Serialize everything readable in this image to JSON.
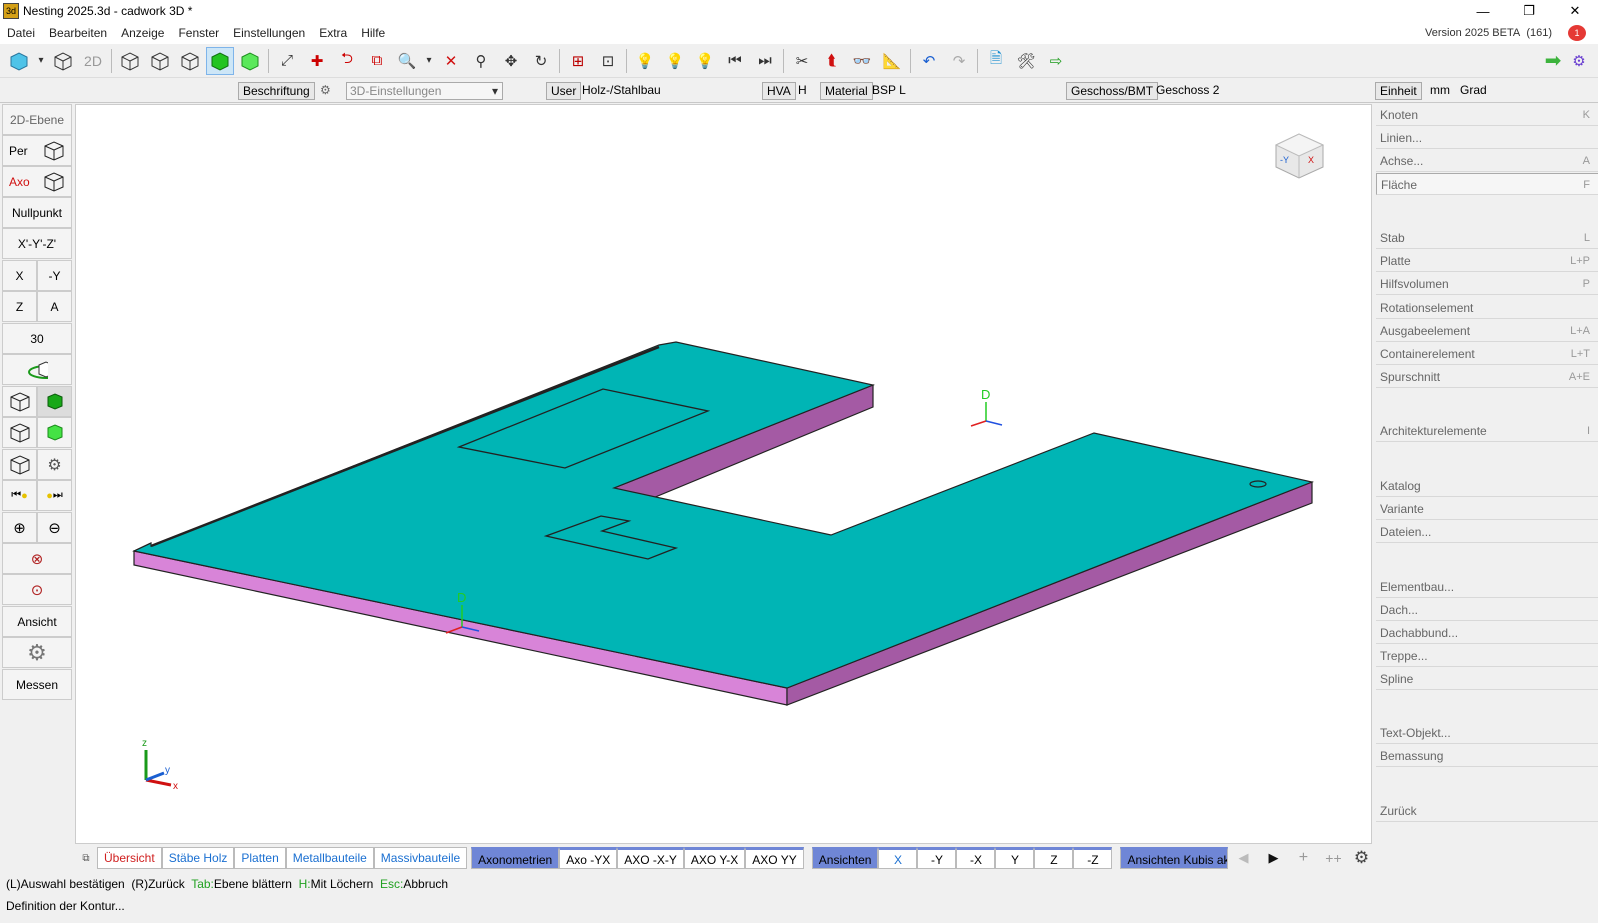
{
  "window": {
    "title": "Nesting 2025.3d - cadwork 3D *",
    "app_icon": "cadwork-3d-icon",
    "controls": [
      "minimize-icon",
      "restore-icon",
      "close-icon"
    ]
  },
  "menu": {
    "items": [
      "Datei",
      "Bearbeiten",
      "Anzeige",
      "Fenster",
      "Einstellungen",
      "Extra",
      "Hilfe"
    ],
    "version": "Version 2025 BETA",
    "build": "(161)",
    "alert_count": "1"
  },
  "toolbar": {
    "label_2d": "2D",
    "icons": [
      "cube-color-icon",
      "cube-wire-icon",
      "2d-icon",
      "cube-icon",
      "cube-icon",
      "cube-icon",
      "cube-green-icon",
      "cube-green-icon",
      "line-icon",
      "plus-icon",
      "rotate-icon",
      "copy-icon",
      "zoom-icon",
      "delete-icon",
      "move-icon",
      "pan-icon",
      "refresh-icon",
      "select-icon",
      "select-icon",
      "bulb-icon",
      "bulb-icon",
      "bulb-icon",
      "prev-icon",
      "next-icon",
      "scissors-icon",
      "axis-icon",
      "binoculars-icon",
      "ruler-icon",
      "undo-icon",
      "redo-icon",
      "add-icon",
      "tools-icon",
      "export-icon"
    ]
  },
  "propbar": {
    "beschriftung": "Beschriftung",
    "einstellungen": "3D-Einstellungen",
    "user_label": "User",
    "user_value": "Holz-/Stahlbau",
    "hva_label": "HVA",
    "hva_value": "H",
    "material_label": "Material",
    "material_value": "BSP L",
    "geschoss_label": "Geschoss/BMT",
    "geschoss_value": "Geschoss 2",
    "einheit_label": "Einheit",
    "unit_length": "mm",
    "unit_angle": "Grad"
  },
  "leftpanel": {
    "ebene": "2D-Ebene",
    "per": "Per",
    "axo": "Axo",
    "nullpunkt": "Nullpunkt",
    "xyz": "X'-Y'-Z'",
    "x": "X",
    "my": "-Y",
    "z": "Z",
    "a": "A",
    "thirty": "30",
    "ansicht": "Ansicht",
    "messen": "Messen"
  },
  "viewport": {
    "local_axis_label": "D",
    "global_axis_z": "z",
    "global_axis_y": "y",
    "global_axis_x": "x",
    "cube_y": "-Y",
    "cube_x": "X",
    "colors": {
      "top": "#00b5b5",
      "side": "#d47fd4",
      "side_dark": "#a45aa4"
    }
  },
  "rightpanel": {
    "items": [
      {
        "label": "Knoten",
        "shortcut": "K"
      },
      {
        "label": "Linien...",
        "shortcut": ""
      },
      {
        "label": "Achse...",
        "shortcut": "A"
      },
      {
        "label": "Fläche",
        "shortcut": "F"
      },
      {
        "label": "Stab",
        "shortcut": "L"
      },
      {
        "label": "Platte",
        "shortcut": "L+P"
      },
      {
        "label": "Hilfsvolumen",
        "shortcut": "P"
      },
      {
        "label": "Rotationselement",
        "shortcut": ""
      },
      {
        "label": "Ausgabeelement",
        "shortcut": "L+A"
      },
      {
        "label": "Containerelement",
        "shortcut": "L+T"
      },
      {
        "label": "Spurschnitt",
        "shortcut": "A+E"
      },
      {
        "label": "Architekturelemente",
        "shortcut": "I"
      },
      {
        "label": "Katalog",
        "shortcut": ""
      },
      {
        "label": "Variante",
        "shortcut": ""
      },
      {
        "label": "Dateien...",
        "shortcut": ""
      },
      {
        "label": "Elementbau...",
        "shortcut": ""
      },
      {
        "label": "Dach...",
        "shortcut": ""
      },
      {
        "label": "Dachabbund...",
        "shortcut": ""
      },
      {
        "label": "Treppe...",
        "shortcut": ""
      },
      {
        "label": "Spline",
        "shortcut": ""
      },
      {
        "label": "Text-Objekt...",
        "shortcut": ""
      },
      {
        "label": "Bemassung",
        "shortcut": ""
      },
      {
        "label": "Zurück",
        "shortcut": ""
      }
    ]
  },
  "tabs": {
    "items": [
      "Übersicht",
      "Stäbe Holz",
      "Platten",
      "Metallbauteile",
      "Massivbauteile",
      "Axonometrien",
      "Axo -YX",
      "AXO -X-Y",
      "AXO Y-X",
      "AXO YY",
      "Ansichten",
      "X",
      "-Y",
      "-X",
      "Y",
      "Z",
      "-Z",
      "Ansichten Kubis ak"
    ],
    "add": "+",
    "add_all": "++"
  },
  "status": {
    "p1": "(L)Auswahl bestätigen",
    "p2": "(R)Zurück",
    "k3": "Tab:",
    "p3": "Ebene blättern",
    "k4": "H:",
    "p4": "Mit Löchern",
    "k5": "Esc:",
    "p5": "Abbruch",
    "line2": "Definition der Kontur..."
  }
}
